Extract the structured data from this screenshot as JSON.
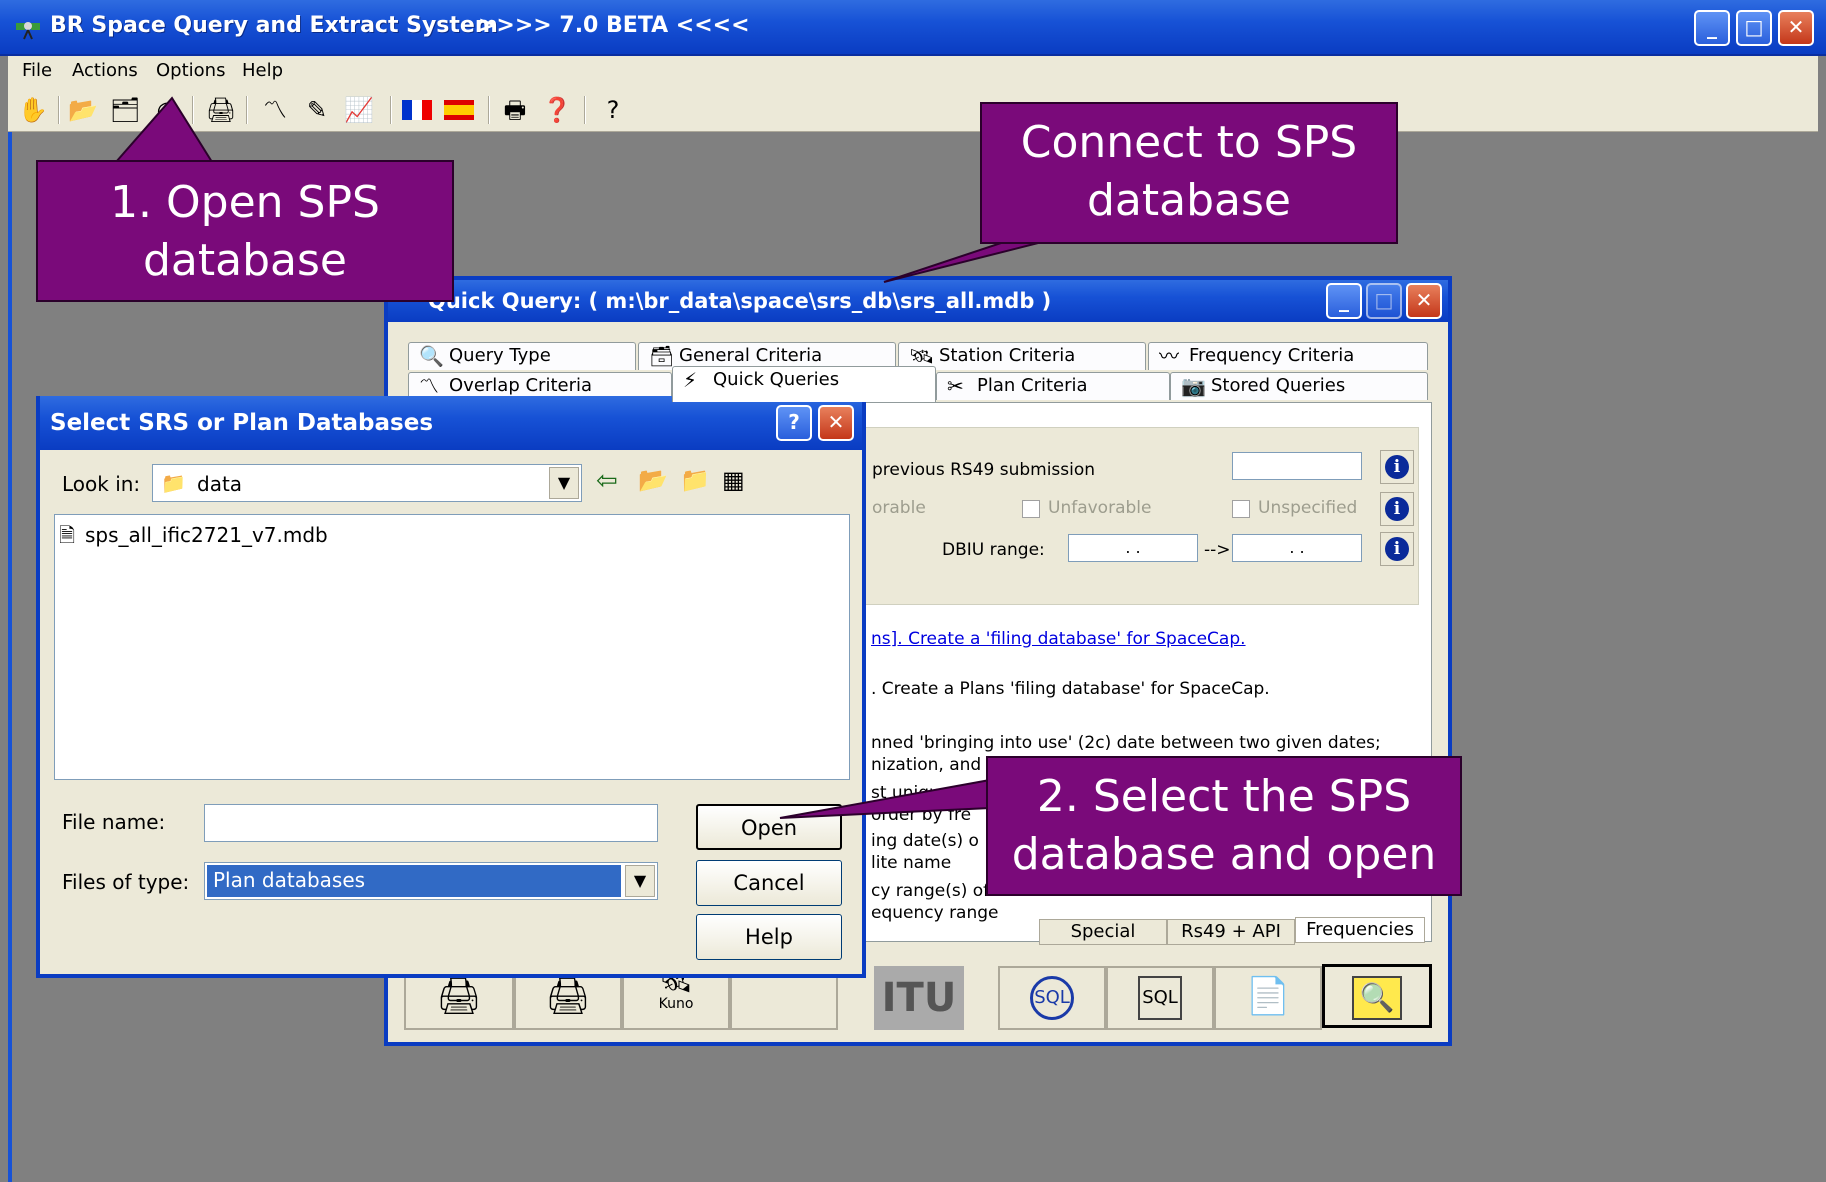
{
  "main_window": {
    "title": "BR Space Query and Extract System",
    "version_label": ">>>> 7.0 BETA <<<<",
    "controls": {
      "minimize": "_",
      "maximize": "□",
      "close": "✕"
    }
  },
  "menu": {
    "file": "File",
    "actions": "Actions",
    "options": "Options",
    "help": "Help"
  },
  "toolbar_icons": [
    "hand-icon",
    "open-folder-icon",
    "open-multi-folder-icon",
    "connect-database-icon",
    "print-preview-icon",
    "chart-icon",
    "edit-chart-icon",
    "graph-icon",
    "french-flag-icon",
    "spanish-flag-icon",
    "export-icon",
    "help-book-icon",
    "whats-this-icon"
  ],
  "quick_query": {
    "title": "Quick Query:   ( m:\\br_data\\space\\srs_db\\srs_all.mdb )",
    "tabs_row1": [
      "Query Type",
      "General Criteria",
      "Station Criteria",
      "Frequency Criteria"
    ],
    "tabs_row2": [
      "Overlap Criteria",
      "Quick Queries",
      "Plan Criteria",
      "Stored Queries"
    ],
    "active_tab": "Quick Queries",
    "prev_submission_label": "previous RS49 submission",
    "favorable_partial": "orable",
    "unfavorable_label": "Unfavorable",
    "unspecified_label": "Unspecified",
    "dbiu_label": "DBIU range:",
    "dbiu_from": ". .",
    "dbiu_arrow": "-->",
    "dbiu_to": ". .",
    "queries": [
      {
        "text": "ns]. Create a 'filing database' for SpaceCap.",
        "link": true
      },
      {
        "text": ". Create a Plans 'filing database' for SpaceCap.",
        "link": false
      },
      {
        "text": "nned 'bringing into use' (2c) date between two given dates;",
        "link": false
      },
      {
        "text": "nization, and satellite name.",
        "link": false
      },
      {
        "text": "st unique freq",
        "link": false
      },
      {
        "text": "order by fre",
        "link": false
      },
      {
        "text": "ing date(s) o",
        "link": false
      },
      {
        "text": "lite name",
        "link": false
      },
      {
        "text": "cy range(s) of",
        "link": false
      },
      {
        "text": "equency range",
        "link": false
      }
    ],
    "bottom_tabs": [
      "Special",
      "Rs49 + API",
      "Frequencies"
    ],
    "bottom_buttons_label_kuno": "Kuno",
    "itu_logo": "ITU",
    "sql_label": "SQL"
  },
  "select_dialog": {
    "title": "Select SRS or Plan Databases",
    "help_btn": "?",
    "close_btn": "✕",
    "look_in_label": "Look in:",
    "look_in_value": "data",
    "files": [
      "sps_all_ific2721_v7.mdb"
    ],
    "file_name_label": "File name:",
    "file_name_value": "",
    "files_of_type_label": "Files of type:",
    "files_of_type_value": "Plan databases",
    "open_label": "Open",
    "cancel_label": "Cancel",
    "help_label": "Help"
  },
  "callouts": {
    "open_sps": "1. Open SPS\ndatabase",
    "connect_sps": "Connect to SPS\ndatabase",
    "select_sps": "2. Select the SPS\ndatabase and open"
  }
}
